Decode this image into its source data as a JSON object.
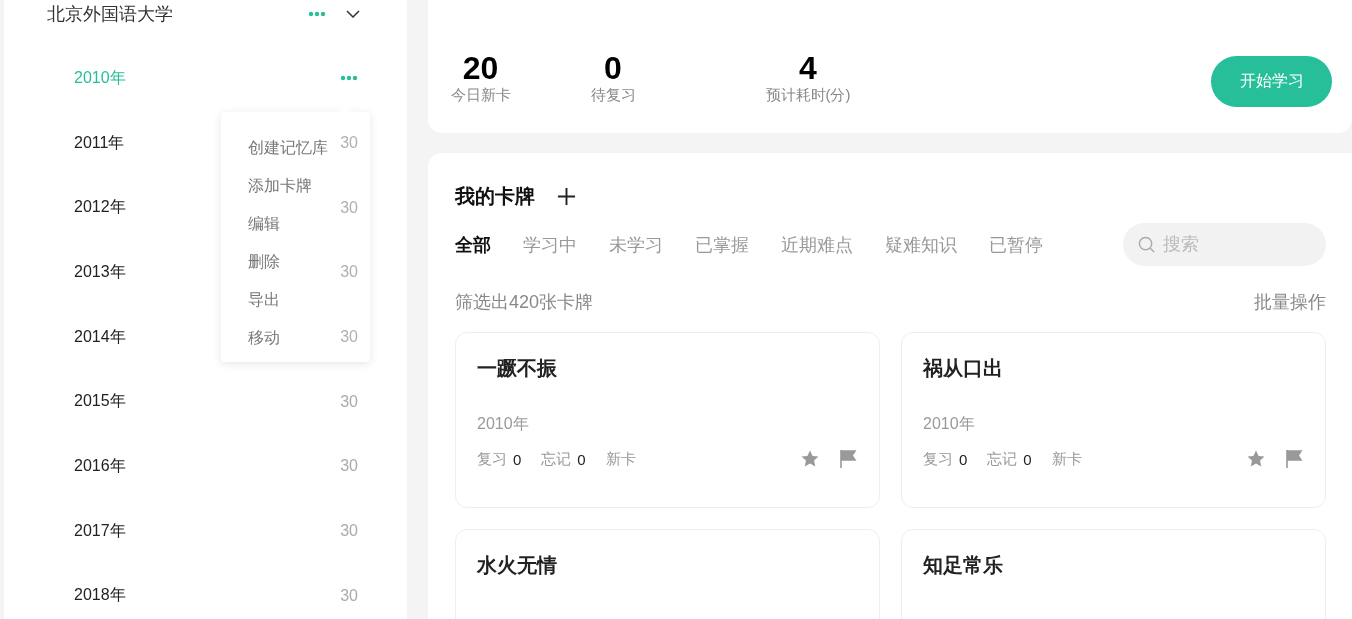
{
  "sidebar": {
    "title": "北京外国语大学",
    "expanded": true,
    "items": [
      {
        "label": "2010年",
        "selected": true
      },
      {
        "label": "2011年",
        "selected": false,
        "count": "30"
      },
      {
        "label": "2012年",
        "selected": false,
        "count": "30"
      },
      {
        "label": "2013年",
        "selected": false,
        "count": "30"
      },
      {
        "label": "2014年",
        "selected": false,
        "count": "30"
      },
      {
        "label": "2015年",
        "selected": false,
        "count": "30"
      },
      {
        "label": "2016年",
        "selected": false,
        "count": "30"
      },
      {
        "label": "2017年",
        "selected": false,
        "count": "30"
      },
      {
        "label": "2018年",
        "selected": false,
        "count": "30"
      }
    ],
    "context_menu": [
      "创建记忆库",
      "添加卡牌",
      "编辑",
      "删除",
      "导出",
      "移动"
    ]
  },
  "stats": [
    {
      "value": "20",
      "label": "今日新卡"
    },
    {
      "value": "0",
      "label": "待复习"
    },
    {
      "value": "4",
      "label": "预计耗时(分)"
    }
  ],
  "start_button": "开始学习",
  "deck": {
    "title": "我的卡牌",
    "tabs": [
      {
        "label": "全部",
        "selected": true
      },
      {
        "label": "学习中",
        "selected": false
      },
      {
        "label": "未学习",
        "selected": false
      },
      {
        "label": "已掌握",
        "selected": false
      },
      {
        "label": "近期难点",
        "selected": false
      },
      {
        "label": "疑难知识",
        "selected": false
      },
      {
        "label": "已暂停",
        "selected": false
      }
    ],
    "search": {
      "placeholder": "搜索"
    },
    "filter_summary": "筛选出420张卡牌",
    "batch_action": "批量操作",
    "cards": [
      {
        "title": "一蹶不振",
        "year": "2010年",
        "review_label": "复习",
        "review": "0",
        "forget_label": "忘记",
        "forget": "0",
        "status": "新卡",
        "starred": false,
        "flagged": false
      },
      {
        "title": "祸从口出",
        "year": "2010年",
        "review_label": "复习",
        "review": "0",
        "forget_label": "忘记",
        "forget": "0",
        "status": "新卡",
        "starred": false,
        "flagged": false
      },
      {
        "title": "水火无情"
      },
      {
        "title": "知足常乐"
      }
    ]
  }
}
